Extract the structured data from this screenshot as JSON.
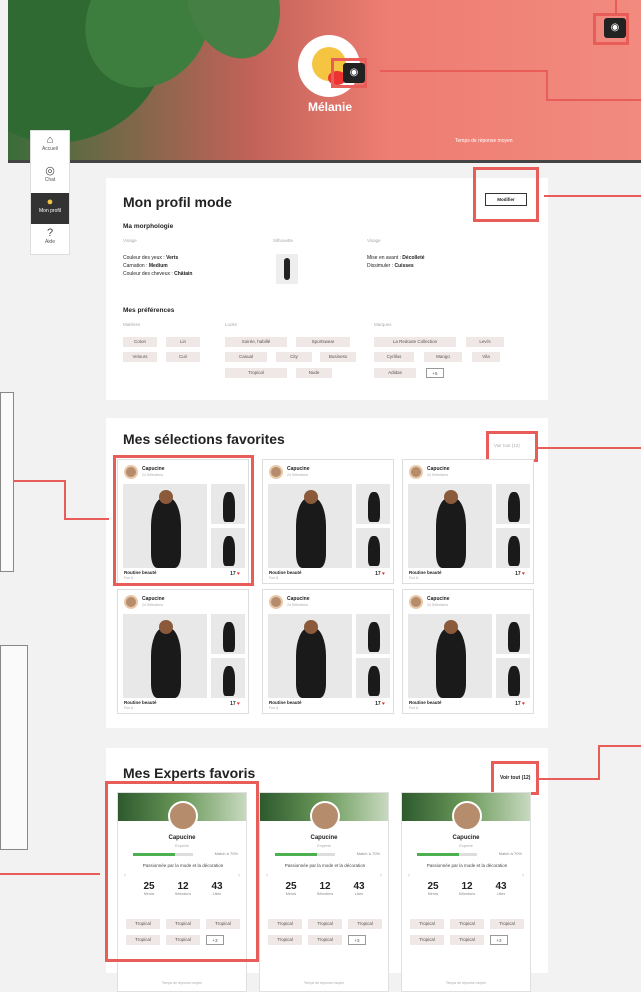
{
  "hero": {
    "name": "Mélanie",
    "response": "Temps de réponse moyen"
  },
  "sidebar": [
    {
      "icon": "⌂",
      "label": "Accueil"
    },
    {
      "icon": "◎",
      "label": "Chat"
    },
    {
      "icon": "●",
      "label": "Mon profil"
    },
    {
      "icon": "?",
      "label": "Aide"
    }
  ],
  "profile": {
    "title": "Mon profil mode",
    "edit": "Modifier",
    "morpho_title": "Ma morphologie",
    "col1_head": "Visage",
    "col2_head": "Silhouette",
    "col3_head": "Visage",
    "eyes_label": "Couleur des yeux : ",
    "eyes": "Verts",
    "skin_label": "Carnation : ",
    "skin": "Medium",
    "hair_label": "Couleur des cheveux : ",
    "hair": "Châtain",
    "highlight_label": "Mise en avant : ",
    "highlight": "Décolleté",
    "hide_label": "Dissimuler : ",
    "hide": "Cuisses",
    "pref_title": "Mes préférences",
    "mat_head": "Matières",
    "look_head": "Looks",
    "brand_head": "Marques",
    "materials": [
      "Coton",
      "Lin",
      "Velours",
      "Cuir"
    ],
    "looks": [
      "Soirée, habillé",
      "Sportswear",
      "Casual",
      "City",
      "Business",
      "Tropical",
      "Nude"
    ],
    "brands": [
      "La Redoute Collection",
      "Levi's",
      "Cyrillus",
      "Mango",
      "Vila",
      "Adidas",
      "+5"
    ]
  },
  "selections": {
    "title": "Mes sélections favorites",
    "see_all": "Voir tout (12)",
    "items": [
      {
        "name": "Capucine",
        "count": "24 Sélections",
        "title": "Routine beauté",
        "sub": "Fun &",
        "likes": "17"
      },
      {
        "name": "Capucine",
        "count": "24 Sélections",
        "title": "Routine beauté",
        "sub": "Fun &",
        "likes": "17"
      },
      {
        "name": "Capucine",
        "count": "24 Sélections",
        "title": "Routine beauté",
        "sub": "Fun &",
        "likes": "17"
      },
      {
        "name": "Capucine",
        "count": "24 Sélections",
        "title": "Routine beauté",
        "sub": "Fun &",
        "likes": "17"
      },
      {
        "name": "Capucine",
        "count": "24 Sélections",
        "title": "Routine beauté",
        "sub": "Fun &",
        "likes": "17"
      },
      {
        "name": "Capucine",
        "count": "24 Sélections",
        "title": "Routine beauté",
        "sub": "Fun &",
        "likes": "17"
      }
    ]
  },
  "experts": {
    "title": "Mes Experts favoris",
    "see_all": "Voir tout (12)",
    "items": [
      {
        "name": "Capucine",
        "role": "Experte",
        "match": "Match à 70%",
        "desc": "Passionnée par la mode et la décoration",
        "mercis": "25",
        "mercis_l": "Mercis",
        "sel": "12",
        "sel_l": "Sélections",
        "likes": "43",
        "likes_l": "Likes",
        "chips": [
          "Tropical",
          "Tropical",
          "Tropical",
          "Tropical",
          "Tropical",
          "+3"
        ],
        "foot": "Temps de réponse moyen"
      },
      {
        "name": "Capucine",
        "role": "Experte",
        "match": "Match à 70%",
        "desc": "Passionnée par la mode et la décoration",
        "mercis": "25",
        "mercis_l": "Mercis",
        "sel": "12",
        "sel_l": "Sélections",
        "likes": "43",
        "likes_l": "Likes",
        "chips": [
          "Tropical",
          "Tropical",
          "Tropical",
          "Tropical",
          "Tropical",
          "+3"
        ],
        "foot": "Temps de réponse moyen"
      },
      {
        "name": "Capucine",
        "role": "Experte",
        "match": "Match à 70%",
        "desc": "Passionnée par la mode et la décoration",
        "mercis": "25",
        "mercis_l": "Mercis",
        "sel": "12",
        "sel_l": "Sélections",
        "likes": "43",
        "likes_l": "Likes",
        "chips": [
          "Tropical",
          "Tropical",
          "Tropical",
          "Tropical",
          "Tropical",
          "+3"
        ],
        "foot": "Temps de réponse moyen"
      }
    ]
  },
  "colors": {
    "accent": "#e95d58",
    "hero": "#f28a80",
    "heart": "#e0322c",
    "bar": "#4caf50"
  }
}
